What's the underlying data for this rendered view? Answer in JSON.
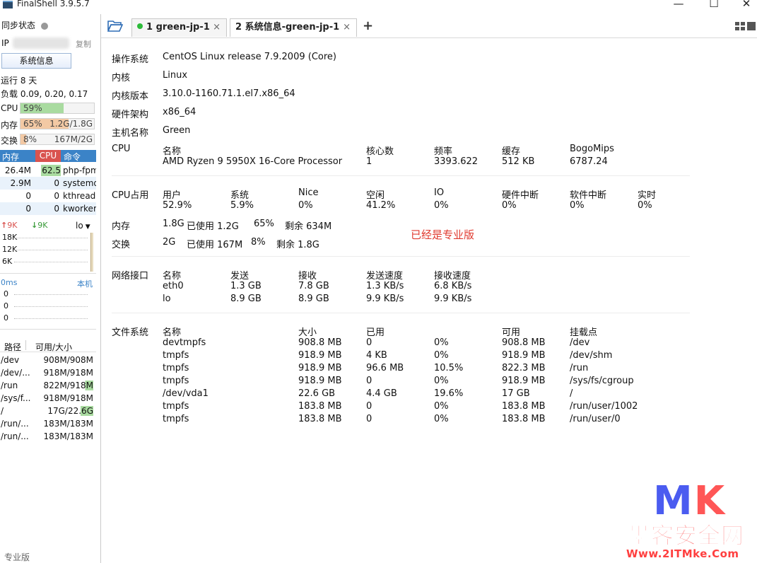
{
  "app": {
    "title": "FinalShell 3.9.5.7",
    "minimize": "—",
    "maximize": "☐",
    "close": "✕"
  },
  "sidebar": {
    "sync_label": "同步状态",
    "ip_label": "IP",
    "copy_label": "复制",
    "sysinfo_button": "系统信息",
    "uptime": "运行 8 天",
    "load": "负载 0.09, 0.20, 0.17",
    "cpu": {
      "label": "CPU",
      "value": "59%",
      "fill": 0.59
    },
    "mem": {
      "label": "内存",
      "value": "65%",
      "detail": "1.2G/1.8G",
      "fill": 0.65
    },
    "swap": {
      "label": "交换",
      "value": "8%",
      "detail": "167M/2G",
      "fill": 0.08
    },
    "proc_headers": {
      "mem": "内存",
      "cpu": "CPU",
      "cmd": "命令"
    },
    "processes": [
      {
        "mem": "26.4M",
        "cpu": "62.5",
        "cmd": "php-fpm"
      },
      {
        "mem": "2.9M",
        "cpu": "0",
        "cmd": "systemd"
      },
      {
        "mem": "0",
        "cpu": "0",
        "cmd": "kthreadd"
      },
      {
        "mem": "0",
        "cpu": "0",
        "cmd": "kworker"
      }
    ],
    "net": {
      "up": "9K",
      "down": "9K",
      "iface": "lo",
      "ticks": [
        "18K",
        "12K",
        "6K"
      ]
    },
    "latency": {
      "value": "0ms",
      "target": "本机",
      "ticks": [
        "0",
        "0",
        "0"
      ]
    },
    "disk_headers": {
      "path": "路径",
      "size": "可用/大小"
    },
    "disks": [
      {
        "path": "/dev",
        "size": "908M/908M"
      },
      {
        "path": "/dev/...",
        "size": "918M/918M"
      },
      {
        "path": "/run",
        "size": "822M/918M"
      },
      {
        "path": "/sys/f...",
        "size": "918M/918M"
      },
      {
        "path": "/",
        "size": "17G/22.6G"
      },
      {
        "path": "/run/...",
        "size": "183M/183M"
      },
      {
        "path": "/run/...",
        "size": "183M/183M"
      }
    ],
    "footer": "专业版"
  },
  "tabs": [
    {
      "label": "1  green-jp-1",
      "close": "×",
      "status_color": "#2dbb3a"
    },
    {
      "label": "2 系统信息-green-jp-1",
      "close": "×"
    }
  ],
  "tab_add": "+",
  "sysinfo": {
    "os_label": "操作系统",
    "os": "CentOS Linux release 7.9.2009 (Core)",
    "kernel_label": "内核",
    "kernel": "Linux",
    "kver_label": "内核版本",
    "kver": "3.10.0-1160.71.1.el7.x86_64",
    "arch_label": "硬件架构",
    "arch": "x86_64",
    "host_label": "主机名称",
    "host": "Green",
    "cpu_label": "CPU",
    "cpu_headers": {
      "name": "名称",
      "cores": "核心数",
      "freq": "频率",
      "cache": "缓存",
      "bogo": "BogoMips"
    },
    "cpu_row": {
      "name": "AMD Ryzen 9 5950X 16-Core Processor",
      "cores": "1",
      "freq": "3393.622",
      "cache": "512 KB",
      "bogo": "6787.24"
    },
    "cpuuse_label": "CPU占用",
    "cpuuse_headers": [
      "用户",
      "系统",
      "Nice",
      "空闲",
      "IO",
      "硬件中断",
      "软件中断",
      "实时"
    ],
    "cpuuse_values": [
      "52.9%",
      "5.9%",
      "0%",
      "41.2%",
      "0%",
      "0%",
      "0%",
      "0%"
    ],
    "mem_label": "内存",
    "mem": {
      "total": "1.8G",
      "used": "已使用 1.2G",
      "pct": "65%",
      "free": "剩余 634M"
    },
    "swap_label": "交换",
    "swap": {
      "total": "2G",
      "used": "已使用 167M",
      "pct": "8%",
      "free": "剩余 1.8G"
    },
    "pro_note": "已经是专业版",
    "net_label": "网络接口",
    "net_headers": [
      "名称",
      "发送",
      "接收",
      "发送速度",
      "接收速度"
    ],
    "net_rows": [
      [
        "eth0",
        "1.3 GB",
        "7.8 GB",
        "1.3 KB/s",
        "6.8 KB/s"
      ],
      [
        "lo",
        "8.9 GB",
        "8.9 GB",
        "9.9 KB/s",
        "9.9 KB/s"
      ]
    ],
    "fs_label": "文件系统",
    "fs_headers": [
      "名称",
      "大小",
      "已用",
      "",
      "可用",
      "挂载点"
    ],
    "fs_rows": [
      [
        "devtmpfs",
        "908.8 MB",
        "0",
        "0%",
        "908.8 MB",
        "/dev"
      ],
      [
        "tmpfs",
        "918.9 MB",
        "4 KB",
        "0%",
        "918.9 MB",
        "/dev/shm"
      ],
      [
        "tmpfs",
        "918.9 MB",
        "96.6 MB",
        "10.5%",
        "822.3 MB",
        "/run"
      ],
      [
        "tmpfs",
        "918.9 MB",
        "0",
        "0%",
        "918.9 MB",
        "/sys/fs/cgroup"
      ],
      [
        "/dev/vda1",
        "22.6 GB",
        "4.4 GB",
        "19.6%",
        "17 GB",
        "/"
      ],
      [
        "tmpfs",
        "183.8 MB",
        "0",
        "0%",
        "183.8 MB",
        "/run/user/1002"
      ],
      [
        "tmpfs",
        "183.8 MB",
        "0",
        "0%",
        "183.8 MB",
        "/run/user/0"
      ]
    ]
  },
  "watermark": {
    "m": "M",
    "k": "K",
    "cn": "墨客安全网",
    "url": "Www.2ITMke.Com"
  },
  "colors": {
    "accent": "#3b83c7",
    "cpu_fill": "#a9dba0",
    "mem_fill": "#f3c9a4",
    "swap_fill": "#f3c9a4",
    "note": "#e03a2f"
  }
}
